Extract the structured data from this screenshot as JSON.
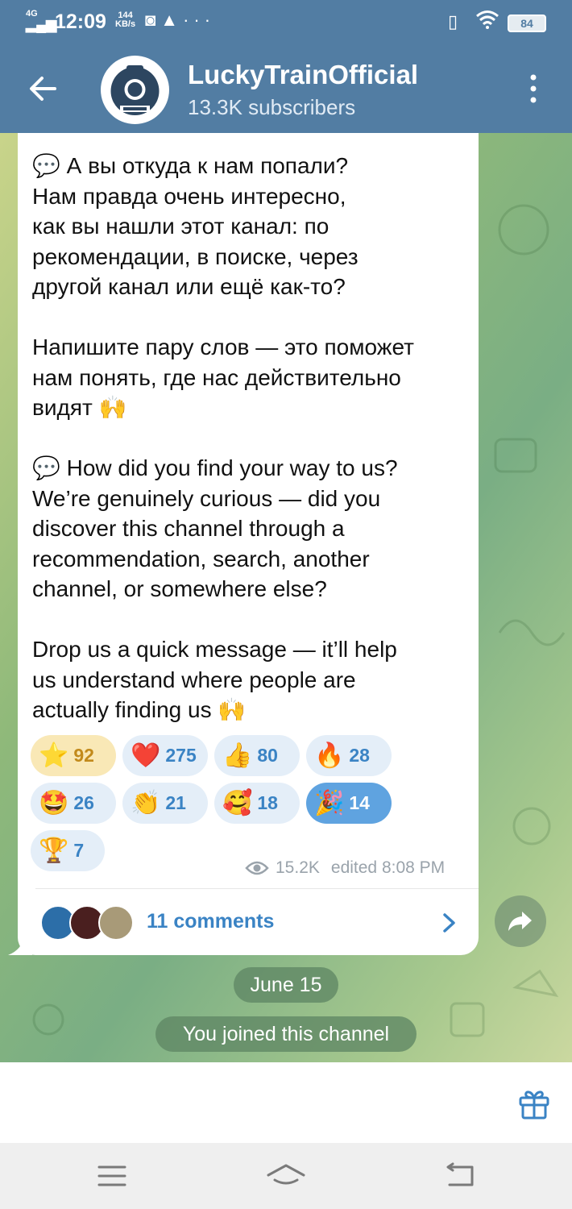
{
  "status_bar": {
    "network": "4G",
    "time": "12:09",
    "speed_value": "144",
    "speed_unit": "KB/s",
    "battery": "84"
  },
  "header": {
    "title": "LuckyTrainOfficial",
    "subtitle": "13.3K subscribers"
  },
  "message": {
    "text": "💬 А вы откуда к нам попали?\nНам правда очень интересно,\nкак вы нашли этот канал: по\nрекомендации, в поиске, через\nдругой канал или ещё как-то?\n\nНапишите пару слов — это поможет\nнам понять, где нас действительно\nвидят 🙌\n\n💬 How did you find your way to us?\nWe’re genuinely curious — did you\ndiscover this channel through a\nrecommendation, search, another\nchannel, or somewhere else?\n\nDrop us a quick message — it’ll help\nus understand where people are\nactually finding us 🙌",
    "reactions": [
      {
        "emoji": "⭐",
        "count": "92"
      },
      {
        "emoji": "❤️",
        "count": "275"
      },
      {
        "emoji": "👍",
        "count": "80"
      },
      {
        "emoji": "🔥",
        "count": "28"
      },
      {
        "emoji": "🤩",
        "count": "26"
      },
      {
        "emoji": "👏",
        "count": "21"
      },
      {
        "emoji": "🥰",
        "count": "18"
      },
      {
        "emoji": "🎉",
        "count": "14"
      },
      {
        "emoji": "🏆",
        "count": "7"
      }
    ],
    "views": "15.2K",
    "edited": "edited 8:08 PM",
    "comments_label": "11 comments"
  },
  "date_pill": "June 15",
  "service_message": "You joined this channel",
  "colors": {
    "header": "#527da3",
    "accent": "#3a83c4",
    "reaction_bg": "#e4eef8",
    "star_reaction_bg": "#f9e8b6",
    "selected_reaction_bg": "#5fa3e0"
  }
}
